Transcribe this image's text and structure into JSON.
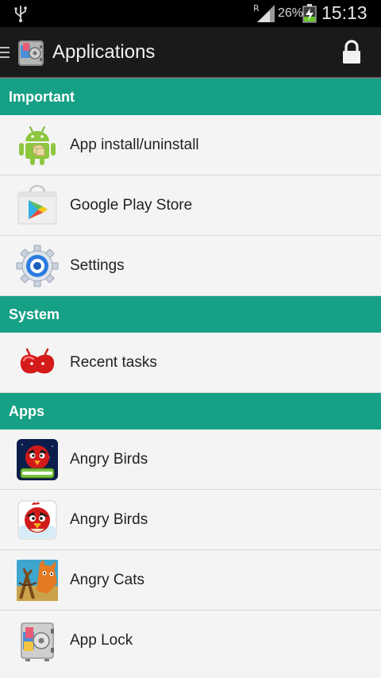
{
  "status_bar": {
    "roaming": "R",
    "battery_percent": "26%",
    "time": "15:13"
  },
  "action_bar": {
    "title": "Applications"
  },
  "sections": [
    {
      "title": "Important",
      "items": [
        {
          "label": "App install/uninstall",
          "icon": "android-icon"
        },
        {
          "label": "Google Play Store",
          "icon": "play-store-icon"
        },
        {
          "label": "Settings",
          "icon": "settings-gear-icon"
        }
      ]
    },
    {
      "title": "System",
      "items": [
        {
          "label": "Recent tasks",
          "icon": "jelly-bean-icon"
        }
      ]
    },
    {
      "title": "Apps",
      "items": [
        {
          "label": "Angry Birds",
          "icon": "angry-birds-space-icon"
        },
        {
          "label": "Angry Birds",
          "icon": "angry-birds-icon"
        },
        {
          "label": "Angry Cats",
          "icon": "angry-cats-icon"
        },
        {
          "label": "App Lock",
          "icon": "app-lock-safe-icon"
        }
      ]
    }
  ],
  "colors": {
    "section_header": "#16a085",
    "action_bar": "#1a1a1a",
    "status_bar": "#000000"
  }
}
